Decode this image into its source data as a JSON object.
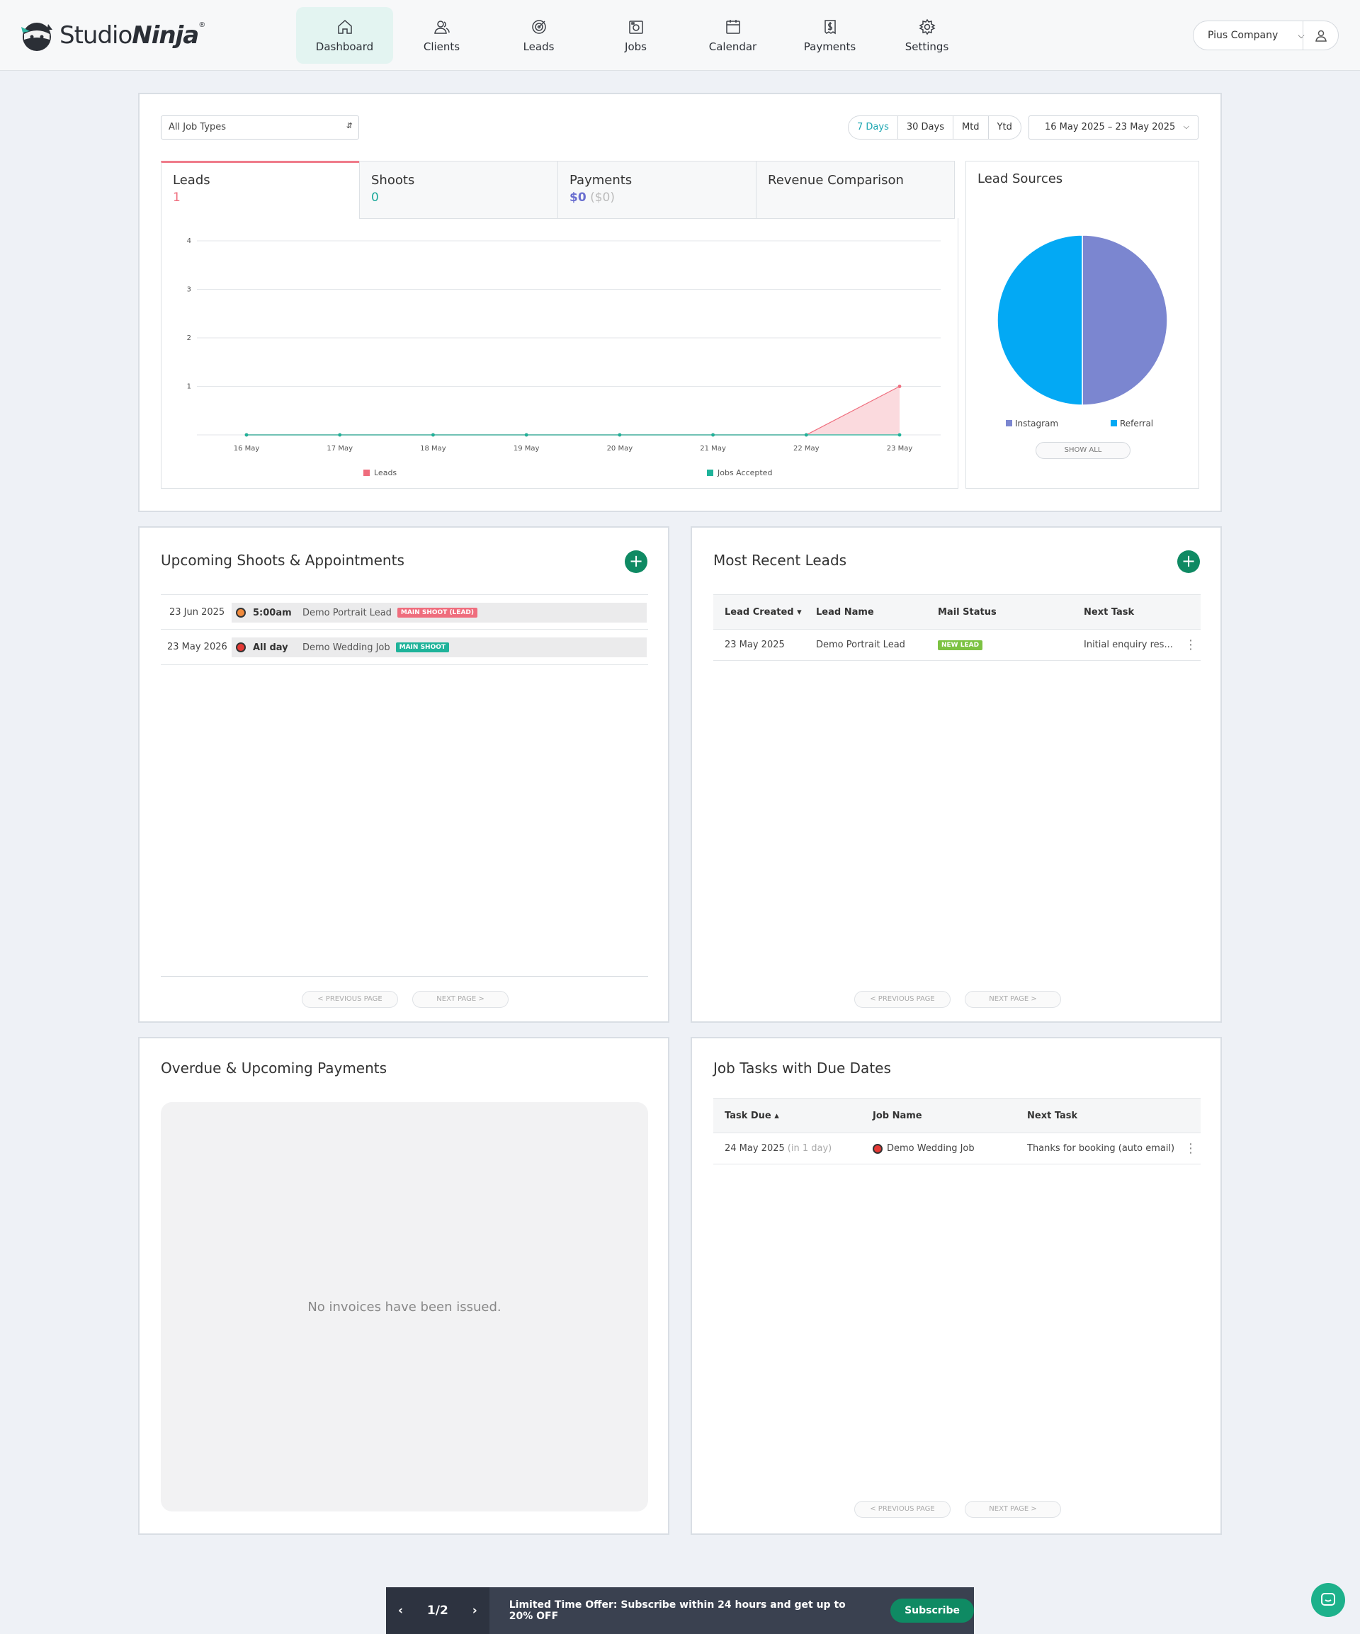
{
  "brand": {
    "name_light": "Studio",
    "name_bold": "Ninja",
    "reg": "®"
  },
  "nav": {
    "items": [
      {
        "label": "Dashboard",
        "icon": "home-icon"
      },
      {
        "label": "Clients",
        "icon": "users-icon"
      },
      {
        "label": "Leads",
        "icon": "target-icon"
      },
      {
        "label": "Jobs",
        "icon": "camera-icon"
      },
      {
        "label": "Calendar",
        "icon": "calendar-icon"
      },
      {
        "label": "Payments",
        "icon": "invoice-icon"
      },
      {
        "label": "Settings",
        "icon": "gear-icon"
      }
    ],
    "active": "Dashboard",
    "company": "Pius Company"
  },
  "filters": {
    "job_type": "All Job Types",
    "ranges": [
      "7 Days",
      "30 Days",
      "Mtd",
      "Ytd"
    ],
    "active_range": "7 Days",
    "date_range": "16 May 2025 – 23 May 2025"
  },
  "stat_tabs": [
    {
      "label": "Leads",
      "value": "1",
      "value_color": "#ef6d7d"
    },
    {
      "label": "Shoots",
      "value": "0",
      "value_color": "#1aa89a"
    },
    {
      "label": "Payments",
      "value": "$0",
      "value_sub": "($0)",
      "value_color": "#6a6fd0"
    },
    {
      "label": "Revenue Comparison",
      "value": ""
    }
  ],
  "chart_data": [
    {
      "type": "area",
      "categories": [
        "16 May",
        "17 May",
        "18 May",
        "19 May",
        "20 May",
        "21 May",
        "22 May",
        "23 May"
      ],
      "series": [
        {
          "name": "Leads",
          "values": [
            0,
            0,
            0,
            0,
            0,
            0,
            0,
            1
          ],
          "color": "#ef6d7d"
        },
        {
          "name": "Jobs Accepted",
          "values": [
            0,
            0,
            0,
            0,
            0,
            0,
            0,
            0
          ],
          "color": "#1fb39a"
        }
      ],
      "ylim": [
        0,
        4
      ],
      "yticks": [
        1,
        2,
        3,
        4
      ],
      "grid": true,
      "legend": "bottom"
    },
    {
      "type": "pie",
      "title": "Lead Sources",
      "slices": [
        {
          "name": "Instagram",
          "value": 1,
          "color": "#7b86d0"
        },
        {
          "name": "Referral",
          "value": 1,
          "color": "#03a9f4"
        }
      ],
      "legend": "bottom",
      "button": "SHOW ALL"
    }
  ],
  "shoots": {
    "title": "Upcoming Shoots & Appointments",
    "rows": [
      {
        "date": "23 Jun 2025",
        "time": "5:00am",
        "name": "Demo Portrait Lead",
        "tag": "MAIN SHOOT (LEAD)",
        "tag_color": "#ef6d7d",
        "dot_color": "#f08a3c"
      },
      {
        "date": "23 May 2026",
        "time": "All day",
        "name": "Demo Wedding Job",
        "tag": "MAIN SHOOT",
        "tag_color": "#1fb39a",
        "dot_color": "#e53935"
      }
    ],
    "prev": "<   PREVIOUS PAGE",
    "next": "NEXT PAGE   >"
  },
  "leads": {
    "title": "Most Recent Leads",
    "columns": [
      "Lead Created ▾",
      "Lead Name",
      "Mail Status",
      "Next Task"
    ],
    "rows": [
      {
        "created": "23 May 2025",
        "name": "Demo Portrait Lead",
        "status": "NEW LEAD",
        "task": "Initial enquiry res..."
      }
    ],
    "status_color": "#7cc242",
    "prev": "<   PREVIOUS PAGE",
    "next": "NEXT PAGE   >"
  },
  "payments": {
    "title": "Overdue & Upcoming Payments",
    "empty": "No invoices have been issued."
  },
  "tasks": {
    "title": "Job Tasks with Due Dates",
    "columns": [
      "Task Due ▴",
      "Job Name",
      "Next Task"
    ],
    "rows": [
      {
        "due": "24 May 2025",
        "due_rel": "(in 1 day)",
        "job": "Demo Wedding Job",
        "task": "Thanks for booking (auto email)"
      }
    ],
    "prev": "<   PREVIOUS PAGE",
    "next": "NEXT PAGE   >"
  },
  "banner": {
    "page": "1/2",
    "prev": "‹",
    "next": "›",
    "text": "Limited Time Offer: Subscribe within 24 hours and get up to 20% OFF",
    "cta": "Subscribe"
  }
}
